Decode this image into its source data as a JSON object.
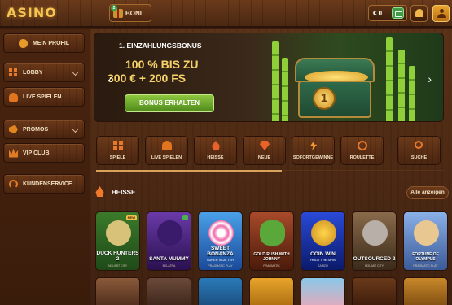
{
  "header": {
    "logo": "ASINO",
    "boni_label": "BONI",
    "boni_badge": "2",
    "balance": "€ 0"
  },
  "sidebar": {
    "items": [
      {
        "label": "MEIN PROFIL",
        "icon": "user-icon"
      },
      {
        "label": "LOBBY",
        "icon": "grid-icon",
        "expandable": true
      },
      {
        "label": "LIVE SPIELEN",
        "icon": "live-dealer-icon"
      },
      {
        "label": "PROMOS",
        "icon": "promo-icon",
        "expandable": true
      },
      {
        "label": "VIP CLUB",
        "icon": "crown-icon"
      },
      {
        "label": "KUNDENSERVICE",
        "icon": "headset-icon"
      }
    ]
  },
  "banner": {
    "kicker": "1. EINZAHLUNGSBONUS",
    "line1": "100 % BIS ZU",
    "line2": "300 € + 200 FS",
    "cta": "BONUS ERHALTEN",
    "coin_number": "1"
  },
  "categories": [
    {
      "label": "SPIELE",
      "icon": "grid-icon"
    },
    {
      "label": "LIVE SPIELEN",
      "icon": "live-dealer-icon"
    },
    {
      "label": "HEISSE",
      "icon": "flame-icon"
    },
    {
      "label": "NEUE",
      "icon": "gem-icon"
    },
    {
      "label": "SOFORTGEWINNE",
      "icon": "bolt-icon"
    },
    {
      "label": "ROULETTE",
      "icon": "roulette-icon"
    },
    {
      "label": "SUCHE",
      "icon": "search-icon"
    }
  ],
  "section": {
    "title": "HEISSE",
    "show_all": "Alle anzeigen"
  },
  "games": [
    {
      "title": "DUCK HUNTERS 2",
      "provider": "NOLIMIT CITY",
      "badge": "NEW",
      "bg": "#2f6a2a"
    },
    {
      "title": "SANTA MUMMY",
      "provider": "BELATRA",
      "badge": "fav",
      "bg": "#5a2a8a"
    },
    {
      "title": "SWEET BONANZA",
      "provider": "PRAGMATIC PLAY",
      "subtitle": "SUPER SCATTER",
      "bg": "#3a8ad8"
    },
    {
      "title": "GOLD RUSH WITH JOHNNY",
      "provider": "PRAGMATIC",
      "bg": "#8a3a1a"
    },
    {
      "title": "COIN WIN",
      "provider": "GAMZIX",
      "subtitle": "HOLD THE SPIN",
      "bg": "#1a3a9a"
    },
    {
      "title": "OUTSOURCED 2",
      "provider": "NOLIMIT CITY",
      "bg": "#6a4a2a"
    },
    {
      "title": "FORTUNE OF OLYMPUS",
      "provider": "PRAGMATIC PLAY",
      "bg": "#6a8ab8"
    }
  ],
  "colors": {
    "accent": "#f7d36a",
    "cta_green": "#6fa82e",
    "wood": "#4a2510"
  }
}
